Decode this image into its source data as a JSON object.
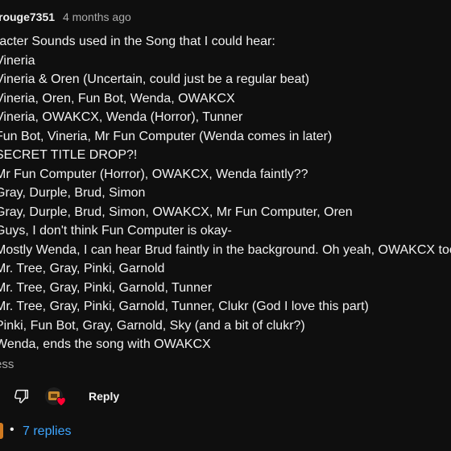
{
  "comment": {
    "author": "rouge7351",
    "timestamp": "4 months ago",
    "lines": [
      "racter Sounds used in the Song that I could hear:",
      "Vineria",
      "Vineria & Oren (Uncertain, could just be a regular beat)",
      "Vineria, Oren, Fun Bot, Wenda, OWAKCX",
      "Vineria, OWAKCX, Wenda (Horror), Tunner",
      "Fun Bot, Vineria, Mr Fun Computer (Wenda comes in later)",
      "SECRET TITLE DROP?!",
      "Mr Fun Computer (Horror), OWAKCX, Wenda faintly??",
      "Gray, Durple, Brud, Simon",
      "Gray, Durple, Brud, Simon, OWAKCX, Mr Fun Computer, Oren",
      "Guys, I don't think Fun Computer is okay-",
      "Mostly Wenda, I can hear Brud faintly in the background. Oh yeah, OWAKCX too",
      "Mr. Tree, Gray, Pinki, Garnold",
      "Mr. Tree, Gray, Pinki, Garnold, Tunner",
      "Mr. Tree, Gray, Pinki, Garnold, Tunner, Clukr (God I love this part)",
      "Pinki, Fun Bot, Gray, Garnold, Sky (and a bit of clukr?)",
      "Wenda, ends the song with OWAKCX"
    ],
    "show_less": "ess"
  },
  "actions": {
    "reply_label": "Reply",
    "dislike_icon": "thumbs-down-icon",
    "creator_heart_icon": "creator-heart-icon"
  },
  "replies": {
    "separator": "•",
    "label": "7 replies",
    "color": "#3ea6ff"
  }
}
